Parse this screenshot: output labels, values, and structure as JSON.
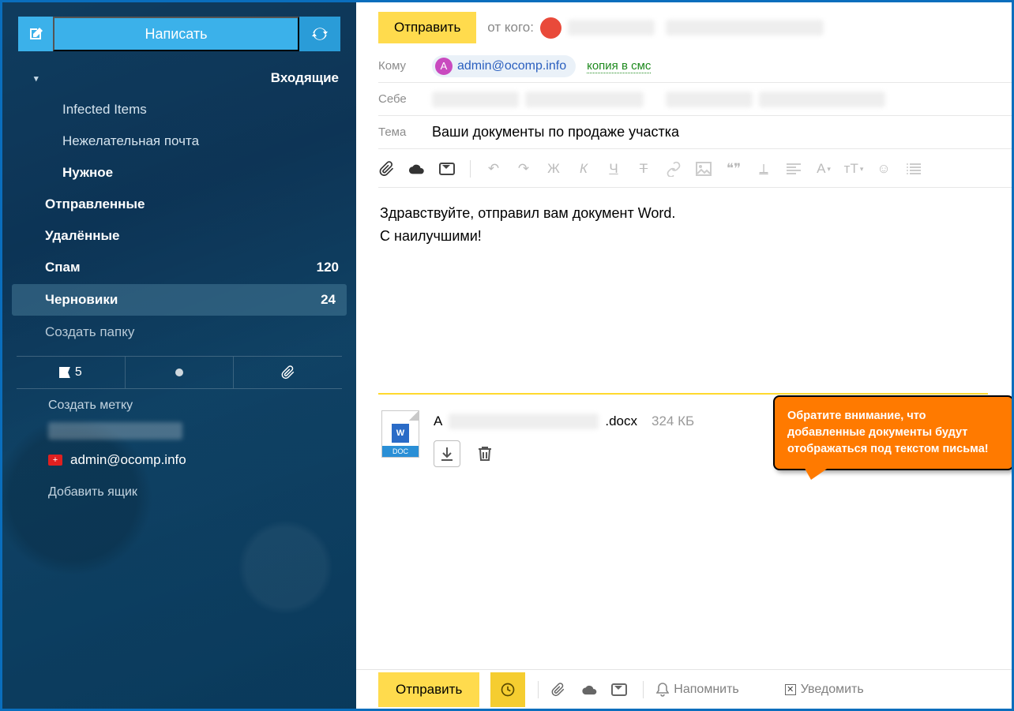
{
  "sidebar": {
    "compose_label": "Написать",
    "folders": {
      "inbox": "Входящие",
      "infected": "Infected Items",
      "junk": "Нежелательная почта",
      "important": "Нужное",
      "sent": "Отправленные",
      "deleted": "Удалённые",
      "spam": "Спам",
      "spam_count": "120",
      "drafts": "Черновики",
      "drafts_count": "24",
      "create_folder": "Создать папку"
    },
    "flag_count": "5",
    "create_label": "Создать метку",
    "account": "admin@ocomp.info",
    "add_mailbox": "Добавить ящик"
  },
  "compose": {
    "send": "Отправить",
    "from_label": "от кого:",
    "to_label": "Кому",
    "to_chip_letter": "А",
    "to_address": "admin@ocomp.info",
    "cc_sms": "копия в смс",
    "self_label": "Себе",
    "subject_label": "Тема",
    "subject_value": "Ваши документы по продаже участка",
    "body_line1": "Здравствуйте, отправил вам документ Word.",
    "body_line2": "С наилучшими!",
    "callout_text": "Обратите внимание, что добавленные документы будут отображаться под текстом письма!",
    "attachment": {
      "name_prefix": "А",
      "ext": ".docx",
      "size": "324 КБ",
      "thumb_w": "W",
      "thumb_doc": "DOC"
    },
    "bottom": {
      "send": "Отправить",
      "remind": "Напомнить",
      "notify": "Уведомить"
    },
    "tb_letters": {
      "zh": "Ж",
      "k": "К",
      "ch": "Ч",
      "t": "Т",
      "a": "А",
      "tt": "тТ"
    }
  }
}
